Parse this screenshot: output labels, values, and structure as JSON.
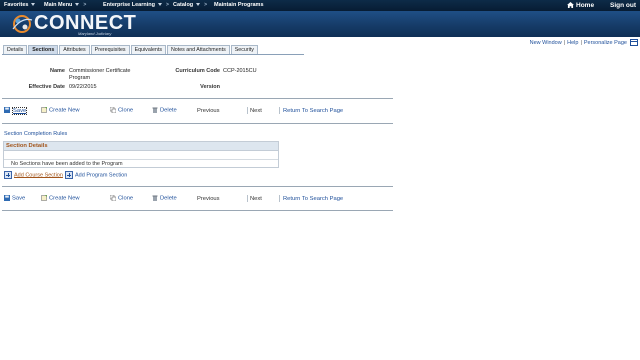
{
  "topnav": {
    "favorites": "Favorites",
    "main_menu": "Main Menu",
    "crumbs": [
      "Enterprise Learning",
      "Catalog",
      "Maintain Programs"
    ],
    "home": "Home",
    "signout": "Sign out"
  },
  "banner": {
    "logo_text": "CONNECT",
    "logo_sub": "Maryland Judiciary"
  },
  "pagelinks": {
    "new_window": "New Window",
    "help": "Help",
    "personalize": "Personalize Page"
  },
  "tabs": [
    "Details",
    "Sections",
    "Attributes",
    "Prerequisites",
    "Equivalents",
    "Notes and Attachments",
    "Security"
  ],
  "active_tab": "Sections",
  "header": {
    "name_label": "Name",
    "name_value_line1": "Commissioner Certificate",
    "name_value_line2": "Program",
    "code_label": "Curriculum Code",
    "code_value": "CCP-2015CU",
    "date_label": "Effective Date",
    "date_value": "09/22/2015",
    "version_label": "Version",
    "version_value": ""
  },
  "toolbar": {
    "save": "Save",
    "create_new": "Create New",
    "clone": "Clone",
    "delete": "Delete",
    "previous": "Previous",
    "next": "Next",
    "return": "Return To Search Page"
  },
  "section_rules": "Section Completion Rules",
  "section_details": {
    "title": "Section Details",
    "empty_msg": "No Sections have been added to the Program"
  },
  "add_course_section": "Add Course Section",
  "add_program_section": "Add Program Section",
  "colors": {
    "nav_bg": "#0d2b48",
    "banner_bg": "#1f4f86",
    "link": "#1e4f9a",
    "section_title": "#a2541a"
  }
}
